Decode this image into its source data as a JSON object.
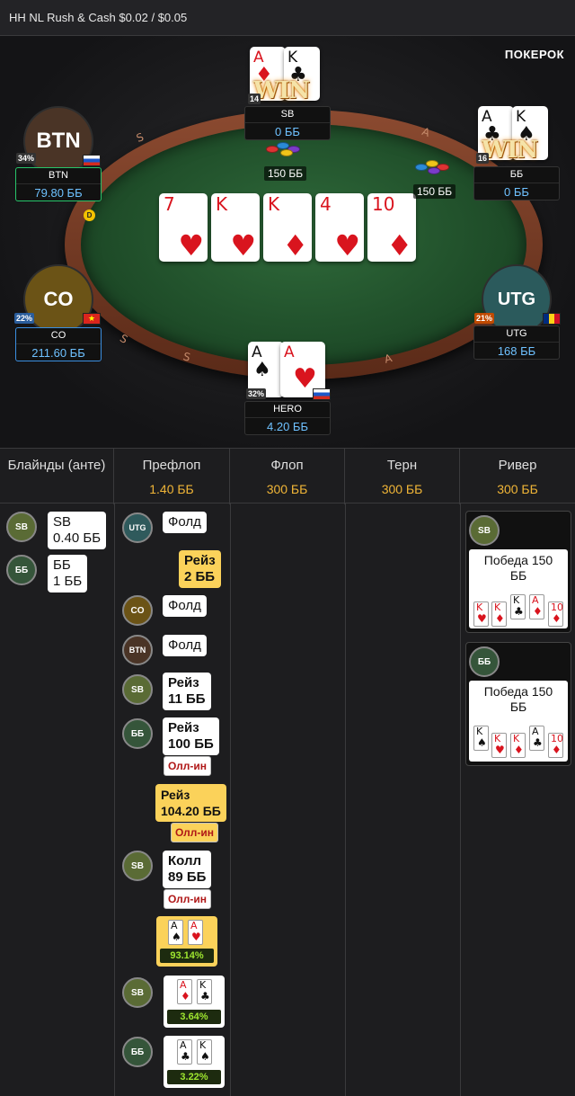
{
  "title": "HH NL Rush & Cash $0.02 / $0.05",
  "logo": "ПОКЕРОК",
  "board": [
    {
      "rank": "7",
      "suit": "♥",
      "color": "red"
    },
    {
      "rank": "K",
      "suit": "♥",
      "color": "red"
    },
    {
      "rank": "K",
      "suit": "♦",
      "color": "red"
    },
    {
      "rank": "4",
      "suit": "♥",
      "color": "red"
    },
    {
      "rank": "10",
      "suit": "♦",
      "color": "red"
    }
  ],
  "seats": {
    "btn": {
      "avatar": "BTN",
      "name": "BTN",
      "stack": "79.80 ББ",
      "pct": "34%",
      "flag": "ru",
      "color": "#4a3426"
    },
    "sb": {
      "name": "SB",
      "stack": "0 ББ",
      "pct": "14",
      "win": "WIN",
      "cards": [
        {
          "rank": "A",
          "suit": "♦",
          "color": "red"
        },
        {
          "rank": "K",
          "suit": "♣",
          "color": "blk"
        }
      ]
    },
    "bb": {
      "name": "ББ",
      "stack": "0 ББ",
      "pct": "16",
      "win": "WIN",
      "cards": [
        {
          "rank": "A",
          "suit": "♣",
          "color": "blk"
        },
        {
          "rank": "K",
          "suit": "♠",
          "color": "blk"
        }
      ]
    },
    "co": {
      "avatar": "CO",
      "name": "CO",
      "stack": "211.60 ББ",
      "pct": "22%",
      "flag": "vn",
      "color": "#6b5316"
    },
    "utg": {
      "avatar": "UTG",
      "name": "UTG",
      "stack": "168 ББ",
      "pct": "21%",
      "flag": "ro",
      "color": "#2b5a5c"
    },
    "hero": {
      "name": "HERO",
      "stack": "4.20 ББ",
      "pct": "32%",
      "flag": "ru",
      "cards": [
        {
          "rank": "A",
          "suit": "♠",
          "color": "blk"
        },
        {
          "rank": "A",
          "suit": "♥",
          "color": "red"
        }
      ]
    }
  },
  "bets": {
    "sb": "150 ББ",
    "bb": "150 ББ"
  },
  "dealer_label": "D",
  "rail_letters": [
    "S",
    "A",
    "S",
    "S",
    "A"
  ],
  "history": {
    "columns": [
      {
        "title": "Блайнды (анте)",
        "value": ""
      },
      {
        "title": "Префлоп",
        "value": "1.40 ББ"
      },
      {
        "title": "Флоп",
        "value": "300 ББ"
      },
      {
        "title": "Терн",
        "value": "300 ББ"
      },
      {
        "title": "Ривер",
        "value": "300 ББ"
      }
    ],
    "blinds": [
      {
        "pos": "SB",
        "line1": "SB",
        "line2": "0.40 ББ"
      },
      {
        "pos": "ББ",
        "line1": "ББ",
        "line2": "1 ББ"
      }
    ],
    "preflop": [
      {
        "pos": "UTG",
        "text": "Фолд"
      },
      {
        "hero": true,
        "line1": "Рейз",
        "line2": "2 ББ"
      },
      {
        "pos": "CO",
        "text": "Фолд"
      },
      {
        "pos": "BTN",
        "text": "Фолд"
      },
      {
        "pos": "SB",
        "line1": "Рейз",
        "line2": "11 ББ"
      },
      {
        "pos": "ББ",
        "line1": "Рейз",
        "line2": "100 ББ",
        "allin": "Олл-ин"
      },
      {
        "hero": true,
        "line1": "Рейз",
        "line2": "104.20 ББ",
        "allin": "Олл-ин"
      },
      {
        "pos": "SB",
        "line1": "Колл",
        "line2": "89 ББ",
        "allin": "Олл-ин"
      }
    ],
    "equities": [
      {
        "hero": true,
        "pos": "",
        "cards": [
          {
            "rank": "A",
            "suit": "♠",
            "color": "blk"
          },
          {
            "rank": "A",
            "suit": "♥",
            "color": "red"
          }
        ],
        "value": "93.14%"
      },
      {
        "hero": false,
        "pos": "SB",
        "cards": [
          {
            "rank": "A",
            "suit": "♦",
            "color": "red"
          },
          {
            "rank": "K",
            "suit": "♣",
            "color": "blk"
          }
        ],
        "value": "3.64%"
      },
      {
        "hero": false,
        "pos": "ББ",
        "cards": [
          {
            "rank": "A",
            "suit": "♣",
            "color": "blk"
          },
          {
            "rank": "K",
            "suit": "♠",
            "color": "blk"
          }
        ],
        "value": "3.22%"
      }
    ],
    "river": [
      {
        "pos": "SB",
        "text": "Победа 150 ББ",
        "cards": [
          {
            "rank": "K",
            "suit": "♥",
            "color": "red"
          },
          {
            "rank": "K",
            "suit": "♦",
            "color": "red"
          },
          {
            "rank": "K",
            "suit": "♣",
            "color": "blk"
          },
          {
            "rank": "A",
            "suit": "♦",
            "color": "red"
          },
          {
            "rank": "10",
            "suit": "♦",
            "color": "red"
          }
        ]
      },
      {
        "pos": "ББ",
        "text": "Победа 150 ББ",
        "cards": [
          {
            "rank": "K",
            "suit": "♠",
            "color": "blk"
          },
          {
            "rank": "K",
            "suit": "♥",
            "color": "red"
          },
          {
            "rank": "K",
            "suit": "♦",
            "color": "red"
          },
          {
            "rank": "A",
            "suit": "♣",
            "color": "blk"
          },
          {
            "rank": "10",
            "suit": "♦",
            "color": "red"
          }
        ]
      }
    ]
  },
  "pos_colors": {
    "SB": "#5a6b35",
    "ББ": "#35553a",
    "UTG": "#2f5a5c",
    "CO": "#6b5316",
    "BTN": "#4a3426"
  }
}
